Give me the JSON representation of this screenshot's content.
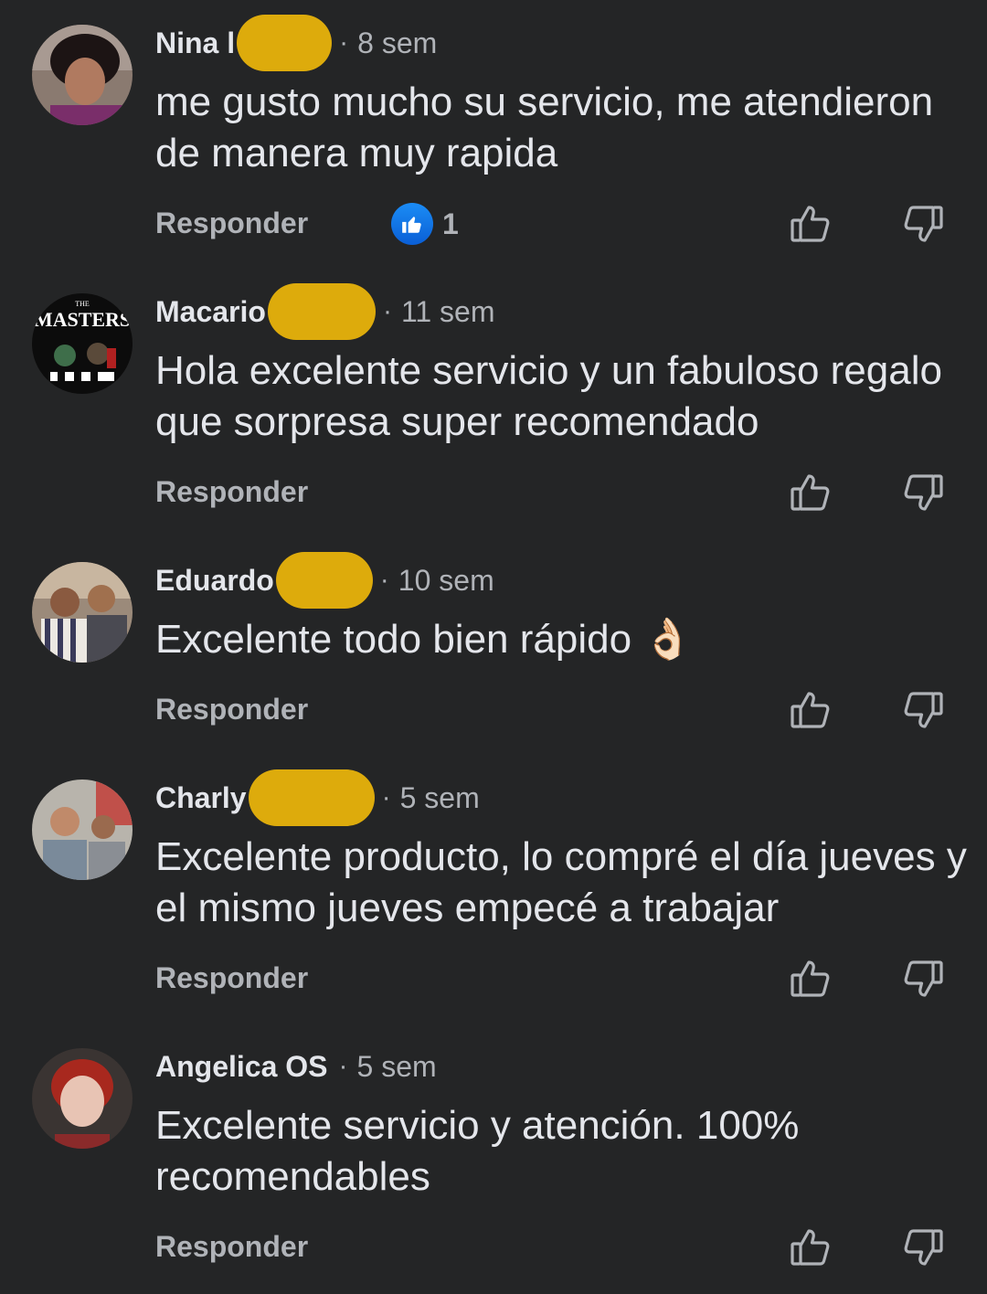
{
  "comments": [
    {
      "name": "Nina l",
      "dot": "·",
      "time": "8 sem",
      "text": "me gusto mucho su servicio, me atendieron de manera muy rapida",
      "reply_label": "Responder",
      "reaction_count": "1"
    },
    {
      "name": "Macario",
      "dot": "·",
      "time": "11 sem",
      "text": "Hola excelente servicio y un fabuloso regalo que sorpresa super recomendado",
      "reply_label": "Responder",
      "avatar_text_small": "THE",
      "avatar_text": "MASTERS"
    },
    {
      "name": "Eduardo",
      "dot": "·",
      "time": "10 sem",
      "text": "Excelente todo bien rápido 👌🏻",
      "reply_label": "Responder"
    },
    {
      "name": "Charly",
      "dot": "·",
      "time": "5 sem",
      "text": "Excelente producto, lo compré el día jueves y el mismo jueves empecé a trabajar",
      "reply_label": "Responder"
    },
    {
      "name": "Angelica OS",
      "dot": "·",
      "time": "5 sem",
      "text": "Excelente servicio y atención. 100% recomendables",
      "reply_label": "Responder"
    }
  ],
  "colors": {
    "background": "#242526",
    "primary_text": "#e4e6eb",
    "secondary_text": "#b0b3b8",
    "redaction": "#ddab0c",
    "like_blue": "#1877f2"
  },
  "icons": [
    "thumbs-up-icon",
    "thumbs-down-icon",
    "like-reaction-icon"
  ]
}
